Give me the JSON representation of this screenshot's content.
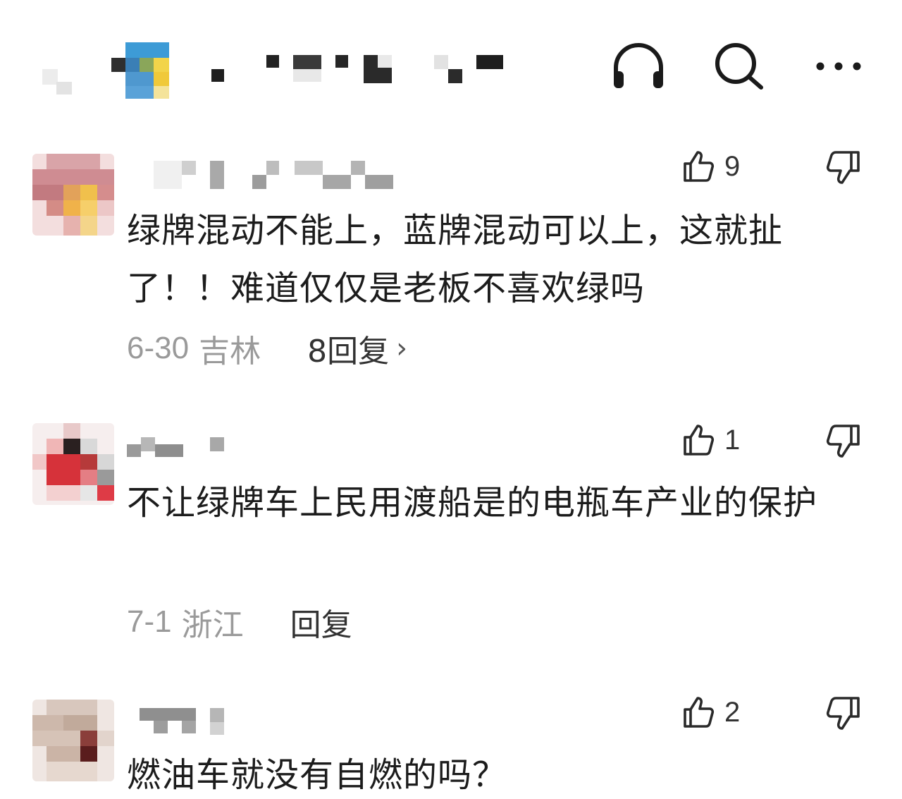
{
  "header": {
    "icons": [
      "headphones-icon",
      "search-icon",
      "more-icon"
    ]
  },
  "comments": [
    {
      "text": "绿牌混动不能上，蓝牌混动可以上，这就扯了！！难道仅仅是老板不喜欢绿吗",
      "likes": "9",
      "date": "6-30",
      "location": "吉林",
      "reply_label": "8回复",
      "reply_chevron": "›"
    },
    {
      "text": "不让绿牌车上民用渡船是的电瓶车产业的保护",
      "likes": "1",
      "date": "7-1",
      "location": "浙江",
      "reply_label": "回复"
    },
    {
      "text": "燃油车就没有自燃的吗？",
      "likes": "2"
    }
  ]
}
